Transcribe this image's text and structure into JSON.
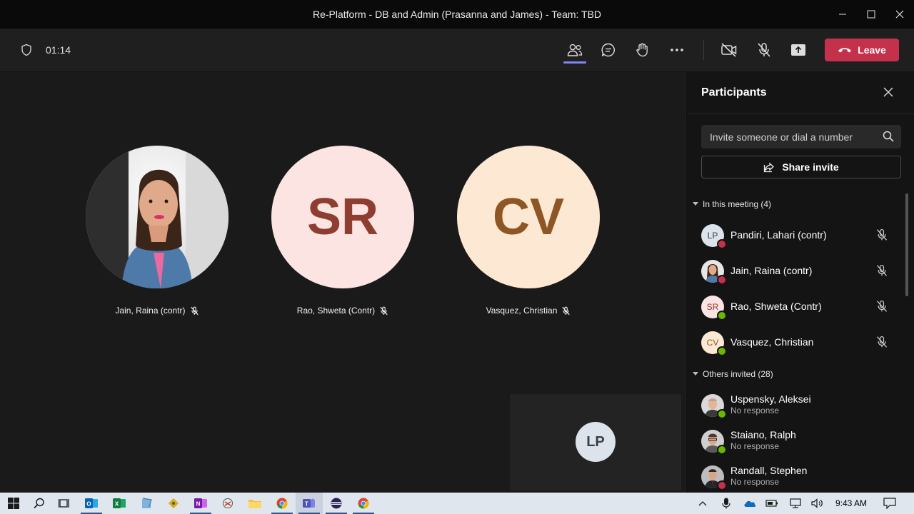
{
  "window": {
    "title": "Re-Platform - DB and Admin (Prasanna and James) - Team: TBD"
  },
  "toolbar": {
    "timer": "01:14",
    "leave_label": "Leave",
    "colors": {
      "leave": "#c4314b",
      "active": "#7f85f5"
    }
  },
  "stage": {
    "tiles": [
      {
        "name": "Jain, Raina (contr)"
      },
      {
        "name": "Rao, Shweta (Contr)",
        "initials": "SR"
      },
      {
        "name": "Vasquez, Christian",
        "initials": "CV"
      }
    ],
    "self": {
      "initials": "LP"
    }
  },
  "panel": {
    "title": "Participants",
    "invite_placeholder": "Invite someone or dial a number",
    "share_label": "Share invite",
    "in_meeting_label": "In this meeting (4)",
    "in_meeting": [
      {
        "name": "Pandiri, Lahari (contr)",
        "initials": "LP"
      },
      {
        "name": "Jain, Raina (contr)"
      },
      {
        "name": "Rao, Shweta (Contr)",
        "initials": "SR"
      },
      {
        "name": "Vasquez, Christian",
        "initials": "CV"
      }
    ],
    "others_label": "Others invited (28)",
    "others": [
      {
        "name": "Uspensky, Aleksei",
        "status": "No response"
      },
      {
        "name": "Staiano, Ralph",
        "status": "No response"
      },
      {
        "name": "Randall, Stephen",
        "status": "No response"
      }
    ]
  },
  "taskbar": {
    "time": "9:43 AM"
  }
}
